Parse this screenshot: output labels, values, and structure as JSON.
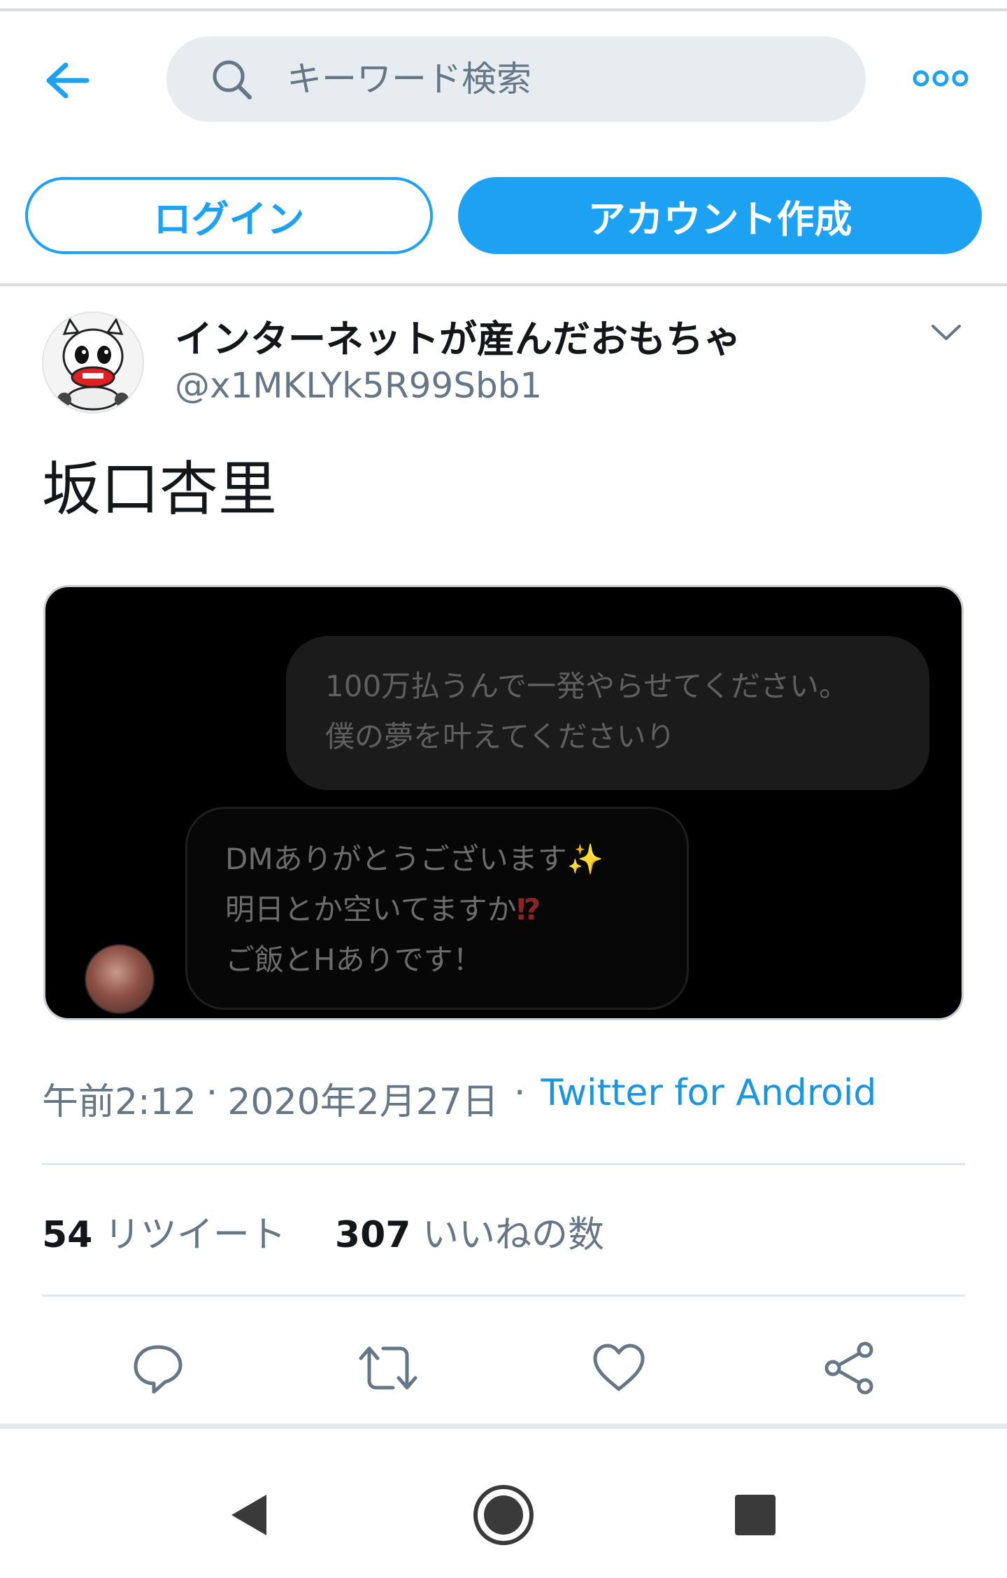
{
  "header": {
    "search_placeholder": "キーワード検索",
    "login_label": "ログイン",
    "signup_label": "アカウント作成"
  },
  "tweet": {
    "display_name": "インターネットが産んだおもちゃ",
    "handle": "@x1MKLYk5R99Sbb1",
    "text": "坂口杏里",
    "media": {
      "outgoing_message": [
        "100万払うんで一発やらせてください。",
        "僕の夢を叶えてくださいり"
      ],
      "incoming_message": [
        "DMありがとうございます",
        "明日とか空いてますか",
        "ご飯とHありです！"
      ],
      "sparkle_glyph": "✨",
      "exclaim_glyph": "⁉"
    },
    "time": "午前2:12",
    "separator": "·",
    "date": "2020年2月27日",
    "source": "Twitter for Android",
    "retweet_count": "54",
    "retweet_label": "リツイート",
    "like_count": "307",
    "like_label": "いいねの数"
  },
  "actions": [
    "reply",
    "retweet",
    "like",
    "share"
  ],
  "colors": {
    "accent": "#1da1f2",
    "link": "#1b95e0",
    "secondary_text": "#657786",
    "primary_text": "#14171a",
    "icon": "#657786"
  }
}
